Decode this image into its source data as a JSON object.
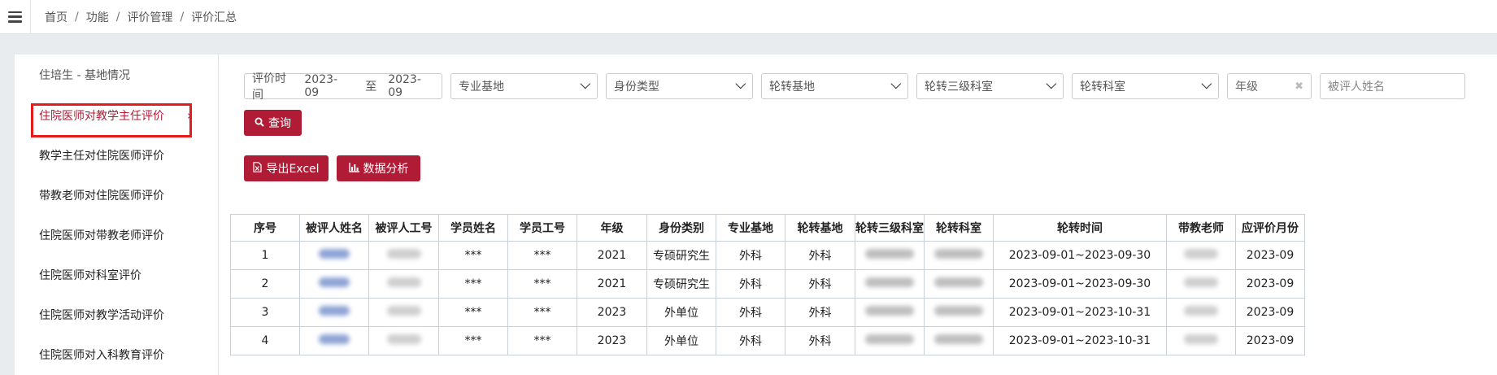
{
  "topbar": {
    "breadcrumb": [
      "首页",
      "功能",
      "评价管理",
      "评价汇总"
    ],
    "separator": "/"
  },
  "sidebar": {
    "header": "住培生 - 基地情况",
    "items": [
      {
        "label": "住院医师对教学主任评价",
        "active": true
      },
      {
        "label": "教学主任对住院医师评价",
        "active": false
      },
      {
        "label": "带教老师对住院医师评价",
        "active": false
      },
      {
        "label": "住院医师对带教老师评价",
        "active": false
      },
      {
        "label": "住院医师对科室评价",
        "active": false
      },
      {
        "label": "住院医师对教学活动评价",
        "active": false
      },
      {
        "label": "住院医师对入科教育评价",
        "active": false
      }
    ],
    "active_chevron": "›"
  },
  "filters": {
    "date_label": "评价时间",
    "date_from": "2023-09",
    "date_to_word": "至",
    "date_to": "2023-09",
    "selects": [
      "专业基地",
      "身份类型",
      "轮转基地",
      "轮转三级科室",
      "轮转科室"
    ],
    "grade_placeholder": "年级",
    "grade_clear": "✖",
    "name_placeholder": "被评人姓名"
  },
  "buttons": {
    "query": "查询",
    "export": "导出Excel",
    "analysis": "数据分析"
  },
  "table": {
    "headers": [
      "序号",
      "被评人姓名",
      "被评人工号",
      "学员姓名",
      "学员工号",
      "年级",
      "身份类别",
      "专业基地",
      "轮转基地",
      "轮转三级科室",
      "轮转科室",
      "轮转时间",
      "带教老师",
      "应评价月份"
    ],
    "rows": [
      {
        "no": "1",
        "student": "***",
        "student_id": "***",
        "grade": "2021",
        "identity": "专硕研究生",
        "major": "外科",
        "rotation_base": "外科",
        "time": "2023-09-01~2023-09-30",
        "month": "2023-09"
      },
      {
        "no": "2",
        "student": "***",
        "student_id": "***",
        "grade": "2021",
        "identity": "专硕研究生",
        "major": "外科",
        "rotation_base": "外科",
        "time": "2023-09-01~2023-09-30",
        "month": "2023-09"
      },
      {
        "no": "3",
        "student": "***",
        "student_id": "***",
        "grade": "2023",
        "identity": "外单位",
        "major": "外科",
        "rotation_base": "外科",
        "time": "2023-09-01~2023-10-31",
        "month": "2023-09"
      },
      {
        "no": "4",
        "student": "***",
        "student_id": "***",
        "grade": "2023",
        "identity": "外单位",
        "major": "外科",
        "rotation_base": "外科",
        "time": "2023-09-01~2023-10-31",
        "month": "2023-09"
      }
    ]
  },
  "colors": {
    "brand": "#b01c35",
    "highlight_box": "#e61b1b"
  }
}
